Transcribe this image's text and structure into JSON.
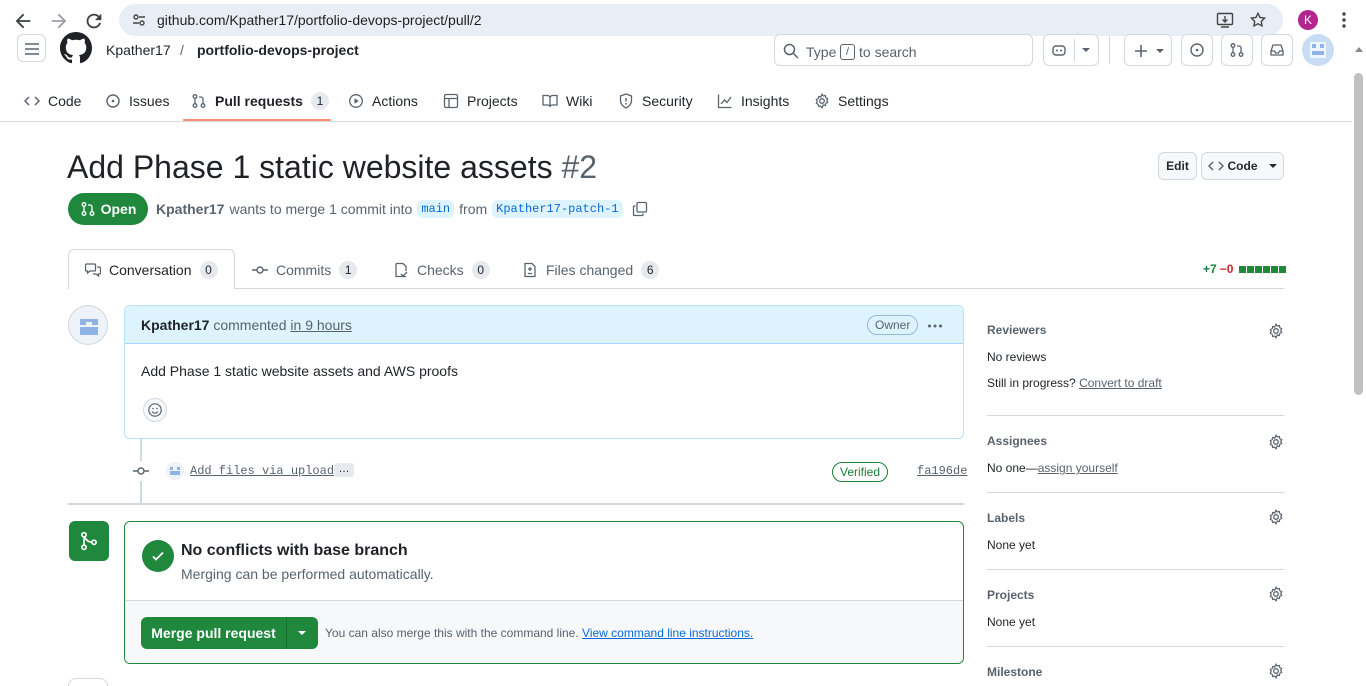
{
  "browser": {
    "url": "github.com/Kpather17/portfolio-devops-project/pull/2",
    "profile_initial": "K"
  },
  "header": {
    "owner": "Kpather17",
    "separator": "/",
    "repo": "portfolio-devops-project",
    "search_placeholder_pre": "Type",
    "search_key": "/",
    "search_placeholder_post": "to search"
  },
  "repo_nav": {
    "code": "Code",
    "issues": "Issues",
    "pull_requests": "Pull requests",
    "pull_requests_count": "1",
    "actions": "Actions",
    "projects": "Projects",
    "wiki": "Wiki",
    "security": "Security",
    "insights": "Insights",
    "settings": "Settings"
  },
  "pr": {
    "title": "Add Phase 1 static website assets",
    "number": "#2",
    "edit_label": "Edit",
    "code_label": "Code",
    "state": "Open",
    "author": "Kpather17",
    "merge_text": "wants to merge 1 commit into",
    "base_branch": "main",
    "from_text": "from",
    "head_branch": "Kpather17-patch-1"
  },
  "tabs": {
    "conversation": "Conversation",
    "conversation_count": "0",
    "commits": "Commits",
    "commits_count": "1",
    "checks": "Checks",
    "checks_count": "0",
    "files_changed": "Files changed",
    "files_changed_count": "6",
    "additions": "+7",
    "deletions": "−0"
  },
  "comment": {
    "author": "Kpather17",
    "action": "commented",
    "time": "in 9 hours",
    "role_badge": "Owner",
    "body": "Add Phase 1 static website assets and AWS proofs"
  },
  "commit": {
    "message": "Add files via upload",
    "ellipsis": "…",
    "verified": "Verified",
    "sha": "fa196de"
  },
  "merge": {
    "title": "No conflicts with base branch",
    "subtitle": "Merging can be performed automatically.",
    "button": "Merge pull request",
    "hint": "You can also merge this with the command line.",
    "hint_link": "View command line instructions."
  },
  "sidebar": {
    "reviewers_title": "Reviewers",
    "reviewers_value": "No reviews",
    "reviewers_progress": "Still in progress?",
    "reviewers_draft_link": "Convert to draft",
    "assignees_title": "Assignees",
    "assignees_value": "No one—",
    "assignees_link": "assign yourself",
    "labels_title": "Labels",
    "labels_value": "None yet",
    "projects_title": "Projects",
    "projects_value": "None yet",
    "milestone_title": "Milestone"
  },
  "colors": {
    "green": "#1f883d",
    "accent_underline": "#fd8c73",
    "link_blue": "#0969da"
  }
}
